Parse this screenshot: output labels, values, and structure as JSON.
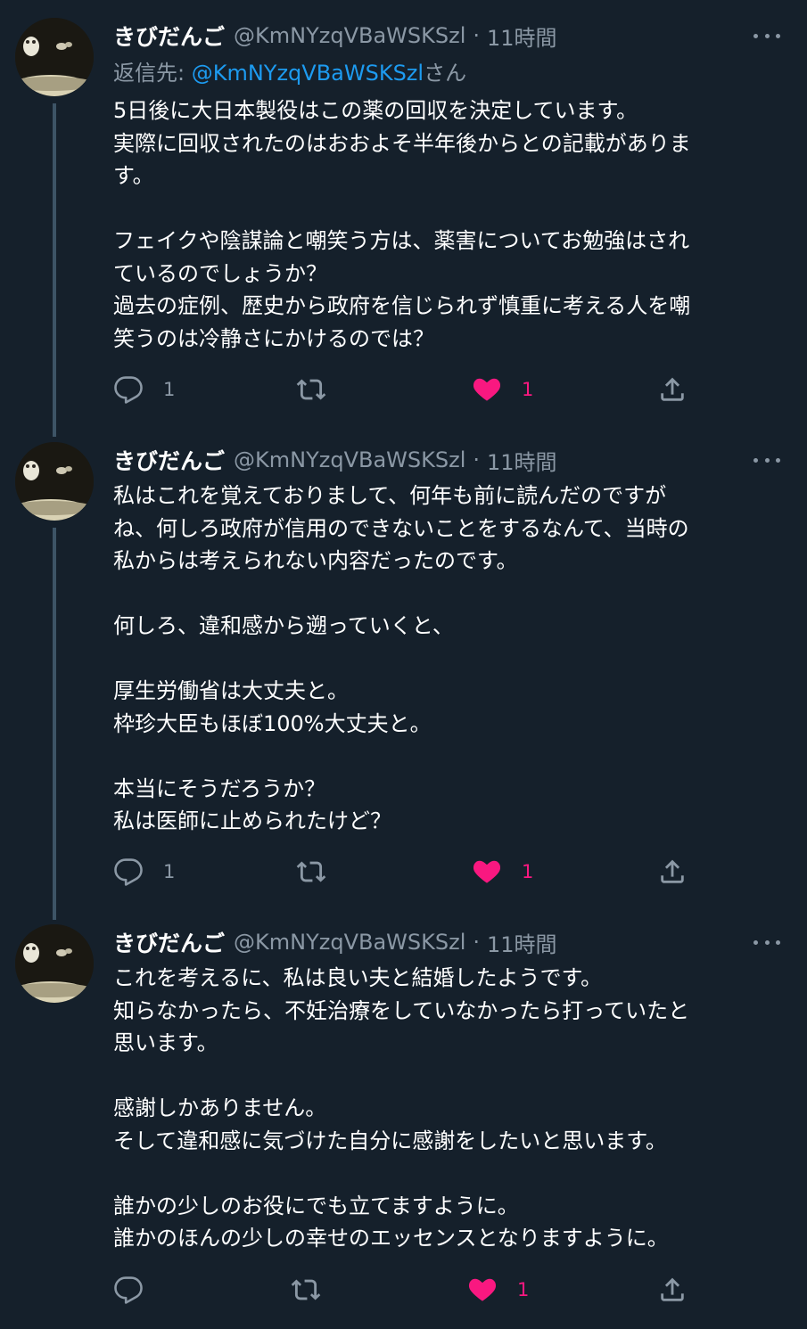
{
  "tweets": [
    {
      "name": "きびだんご",
      "handle": "@KmNYzqVBaWSKSzl",
      "separator": "·",
      "time": "11時間",
      "reply_prefix": "返信先: ",
      "reply_handle": "@KmNYzqVBaWSKSzl",
      "reply_suffix": "さん",
      "lines": [
        "5日後に大日本製役はこの薬の回収を決定しています。",
        "実際に回収されたのはおおよそ半年後からとの記載がありま",
        "す。",
        "",
        "フェイクや陰謀論と嘲笑う方は、薬害についてお勉強はされ",
        "ているのでしょうか？",
        "過去の症例、歴史から政府を信じられず慎重に考える人を嘲",
        "笑うのは冷静さにかけるのでは？"
      ],
      "reply_count": "1",
      "retweet_count": "",
      "like_count": "1"
    },
    {
      "name": "きびだんご",
      "handle": "@KmNYzqVBaWSKSzl",
      "separator": "·",
      "time": "11時間",
      "lines": [
        "私はこれを覚えておりまして、何年も前に読んだのですが",
        "ね、何しろ政府が信用のできないことをするなんて、当時の",
        "私からは考えられない内容だったのです。",
        "",
        "何しろ、違和感から遡っていくと、",
        "",
        "厚生労働省は大丈夫と。",
        "枠珍大臣もほぼ100%大丈夫と。",
        "",
        "本当にそうだろうか？",
        "私は医師に止められたけど？"
      ],
      "reply_count": "1",
      "retweet_count": "",
      "like_count": "1"
    },
    {
      "name": "きびだんご",
      "handle": "@KmNYzqVBaWSKSzl",
      "separator": "·",
      "time": "11時間",
      "lines": [
        "これを考えるに、私は良い夫と結婚したようです。",
        "知らなかったら、不妊治療をしていなかったら打っていたと",
        "思います。",
        "",
        "感謝しかありません。",
        "そして違和感に気づけた自分に感謝をしたいと思います。",
        "",
        "誰かの少しのお役にでも立てますように。",
        "誰かのほんの少しの幸せのエッセンスとなりますように。"
      ],
      "reply_count": "",
      "retweet_count": "",
      "like_count": "1"
    }
  ],
  "icons": {
    "reply": "reply-icon",
    "retweet": "retweet-icon",
    "like": "heart-icon",
    "share": "share-icon",
    "more": "more-icon"
  },
  "colors": {
    "background": "#15202b",
    "text": "#ffffff",
    "secondary": "#8b98a5",
    "link": "#1d9bf0",
    "like": "#f91880",
    "thread_line": "#3d5466"
  }
}
